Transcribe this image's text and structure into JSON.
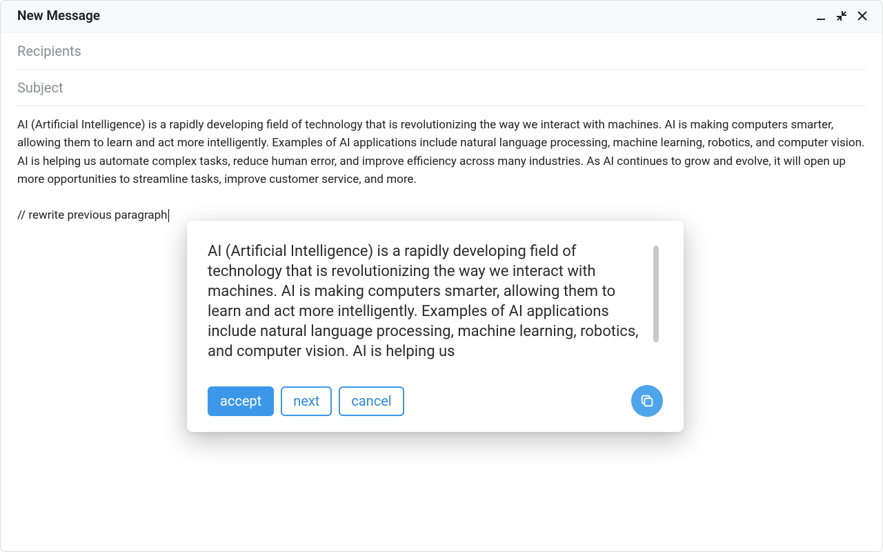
{
  "window": {
    "title": "New Message"
  },
  "fields": {
    "recipients_label": "Recipients",
    "subject_label": "Subject"
  },
  "body": {
    "paragraph": "AI (Artificial Intelligence) is a rapidly developing field of technology that is revolutionizing the way we interact with machines. AI is making computers smarter, allowing them to learn and act more intelligently. Examples of AI applications include natural language processing, machine learning, robotics, and computer vision. AI is helping us automate complex tasks, reduce human error, and improve efficiency across many industries. As AI continues to grow and evolve, it will open up more opportunities to streamline tasks, improve customer service, and more.",
    "command": "// rewrite previous paragraph"
  },
  "popup": {
    "suggestion": "AI (Artificial Intelligence) is a rapidly developing field of technology that is revolutionizing the way we interact with machines. AI is making computers smarter, allowing them to learn and act more intelligently. Examples of AI applications include natural language processing, machine learning, robotics, and computer vision. AI is helping us",
    "accept_label": "accept",
    "next_label": "next",
    "cancel_label": "cancel"
  }
}
